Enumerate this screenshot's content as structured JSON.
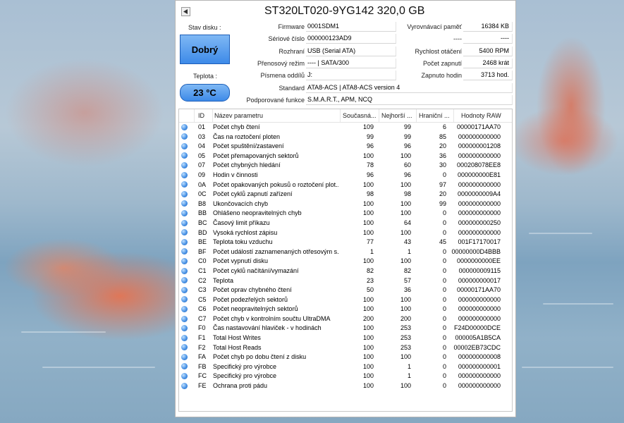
{
  "window": {
    "title": "ST320LT020-9YG142 320,0 GB"
  },
  "status": {
    "health_label": "Stav disku :",
    "health_value": "Dobrý",
    "temp_label": "Teplota :",
    "temp_value": "23 °C"
  },
  "info": {
    "firmware_label": "Firmware",
    "firmware_value": "0001SDM1",
    "serial_label": "Sériové číslo",
    "serial_value": "000000123AD9",
    "interface_label": "Rozhraní",
    "interface_value": "USB (Serial ATA)",
    "transfer_label": "Přenosový režim",
    "transfer_value": "---- | SATA/300",
    "letters_label": "Písmena oddílů",
    "letters_value": "J:",
    "standard_label": "Standard",
    "standard_value": "ATA8-ACS | ATA8-ACS version 4",
    "features_label": "Podporované funkce",
    "features_value": "S.M.A.R.T., APM, NCQ",
    "buffer_label": "Vyrovnávací paměť",
    "buffer_value": "16384 KB",
    "blank1_label": "----",
    "blank1_value": "----",
    "rpm_label": "Rychlost otáčení",
    "rpm_value": "5400 RPM",
    "powercount_label": "Počet zapnutí",
    "powercount_value": "2468 krát",
    "powerhours_label": "Zapnuto hodin",
    "powerhours_value": "3713 hod."
  },
  "table": {
    "headers": [
      "ID",
      "Název parametru",
      "Současná...",
      "Nejhorší ...",
      "Hraniční ...",
      "Hodnoty RAW"
    ],
    "rows": [
      {
        "id": "01",
        "name": "Počet chyb čtení",
        "cur": "109",
        "worst": "99",
        "thr": "6",
        "raw": "00000171AA70"
      },
      {
        "id": "03",
        "name": "Čas na roztočení ploten",
        "cur": "99",
        "worst": "99",
        "thr": "85",
        "raw": "000000000000"
      },
      {
        "id": "04",
        "name": "Počet spuštění/zastavení",
        "cur": "96",
        "worst": "96",
        "thr": "20",
        "raw": "000000001208"
      },
      {
        "id": "05",
        "name": "Počet přemapovaných sektorů",
        "cur": "100",
        "worst": "100",
        "thr": "36",
        "raw": "000000000000"
      },
      {
        "id": "07",
        "name": "Počet chybných hledání",
        "cur": "78",
        "worst": "60",
        "thr": "30",
        "raw": "000208078EE8"
      },
      {
        "id": "09",
        "name": "Hodin v činnosti",
        "cur": "96",
        "worst": "96",
        "thr": "0",
        "raw": "000000000E81"
      },
      {
        "id": "0A",
        "name": "Počet opakovaných pokusů o roztočení plot...",
        "cur": "100",
        "worst": "100",
        "thr": "97",
        "raw": "000000000000"
      },
      {
        "id": "0C",
        "name": "Počet cyklů zapnutí zařízení",
        "cur": "98",
        "worst": "98",
        "thr": "20",
        "raw": "0000000009A4"
      },
      {
        "id": "B8",
        "name": "Ukončovacích chyb",
        "cur": "100",
        "worst": "100",
        "thr": "99",
        "raw": "000000000000"
      },
      {
        "id": "BB",
        "name": "Ohlášeno neopravitelných chyb",
        "cur": "100",
        "worst": "100",
        "thr": "0",
        "raw": "000000000000"
      },
      {
        "id": "BC",
        "name": "Časový limit příkazu",
        "cur": "100",
        "worst": "64",
        "thr": "0",
        "raw": "000000000250"
      },
      {
        "id": "BD",
        "name": "Vysoká rychlost zápisu",
        "cur": "100",
        "worst": "100",
        "thr": "0",
        "raw": "000000000000"
      },
      {
        "id": "BE",
        "name": "Teplota toku vzduchu",
        "cur": "77",
        "worst": "43",
        "thr": "45",
        "raw": "001F17170017"
      },
      {
        "id": "BF",
        "name": "Počet událostí zaznamenaných otřesovým s...",
        "cur": "1",
        "worst": "1",
        "thr": "0",
        "raw": "00000000D4BBB"
      },
      {
        "id": "C0",
        "name": "Počet vypnutí disku",
        "cur": "100",
        "worst": "100",
        "thr": "0",
        "raw": "0000000000EE"
      },
      {
        "id": "C1",
        "name": "Počet cyklů načítání/vymazání",
        "cur": "82",
        "worst": "82",
        "thr": "0",
        "raw": "000000009115"
      },
      {
        "id": "C2",
        "name": "Teplota",
        "cur": "23",
        "worst": "57",
        "thr": "0",
        "raw": "000000000017"
      },
      {
        "id": "C3",
        "name": "Počet oprav chybného čtení",
        "cur": "50",
        "worst": "36",
        "thr": "0",
        "raw": "00000171AA70"
      },
      {
        "id": "C5",
        "name": "Počet podezřelých sektorů",
        "cur": "100",
        "worst": "100",
        "thr": "0",
        "raw": "000000000000"
      },
      {
        "id": "C6",
        "name": "Počet neopravitelných sektorů",
        "cur": "100",
        "worst": "100",
        "thr": "0",
        "raw": "000000000000"
      },
      {
        "id": "C7",
        "name": "Počet chyb v kontrolním součtu UltraDMA",
        "cur": "200",
        "worst": "200",
        "thr": "0",
        "raw": "000000000000"
      },
      {
        "id": "F0",
        "name": "Čas nastavování hlaviček - v hodinách",
        "cur": "100",
        "worst": "253",
        "thr": "0",
        "raw": "F24D00000DCE"
      },
      {
        "id": "F1",
        "name": "Total Host Writes",
        "cur": "100",
        "worst": "253",
        "thr": "0",
        "raw": "000005A1B5CA"
      },
      {
        "id": "F2",
        "name": "Total Host Reads",
        "cur": "100",
        "worst": "253",
        "thr": "0",
        "raw": "00002EB73CDC"
      },
      {
        "id": "FA",
        "name": "Počet chyb po dobu čtení z disku",
        "cur": "100",
        "worst": "100",
        "thr": "0",
        "raw": "000000000008"
      },
      {
        "id": "FB",
        "name": "Specifický pro výrobce",
        "cur": "100",
        "worst": "1",
        "thr": "0",
        "raw": "000000000001"
      },
      {
        "id": "FC",
        "name": "Specifický pro výrobce",
        "cur": "100",
        "worst": "1",
        "thr": "0",
        "raw": "000000000000"
      },
      {
        "id": "FE",
        "name": "Ochrana proti pádu",
        "cur": "100",
        "worst": "100",
        "thr": "0",
        "raw": "000000000000"
      }
    ]
  }
}
